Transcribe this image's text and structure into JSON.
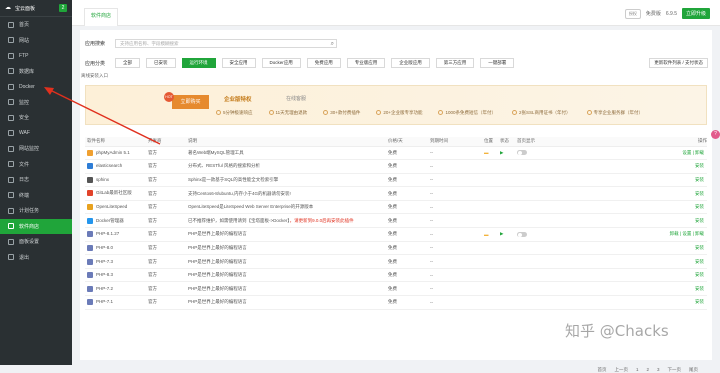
{
  "sidebar": {
    "title": "宝云面板",
    "badge": "2",
    "items": [
      {
        "label": "首页"
      },
      {
        "label": "网站"
      },
      {
        "label": "FTP"
      },
      {
        "label": "数据库"
      },
      {
        "label": "Docker"
      },
      {
        "label": "监控"
      },
      {
        "label": "安全"
      },
      {
        "label": "WAF"
      },
      {
        "label": "网站监控"
      },
      {
        "label": "文件"
      },
      {
        "label": "日志"
      },
      {
        "label": "终端"
      },
      {
        "label": "计划任务"
      },
      {
        "label": "软件商店"
      },
      {
        "label": "面板设置"
      },
      {
        "label": "退出"
      }
    ]
  },
  "topbar": {
    "tab": "软件商店",
    "plan": "免费版",
    "version": "6.9.5",
    "upgrade": "立即升级",
    "tag": "授权"
  },
  "search": {
    "label": "应用搜索",
    "placeholder": "支持应用名称、字段模糊搜索"
  },
  "categories": {
    "label": "应用分类",
    "items": [
      "全部",
      "已安装",
      "运行环境",
      "安全应用",
      "Docker应用",
      "免费应用",
      "专业版应用",
      "企业版应用",
      "第三方应用",
      "一键部署"
    ],
    "refresh": "更新软件列表 / 支付状态"
  },
  "banner": {
    "hot": "HOT",
    "buy": "立即购买",
    "title": "企业版特权",
    "subtitle": "在线客服",
    "features": [
      "5分钟极速响应",
      "11天无理由退款",
      "30+款付费插件",
      "20+企业版专享功能",
      "1000条免费短信（年付）",
      "2张SSL商用证书（年付）",
      "专享企业服务群（年付）"
    ],
    "link": "离线安装入口"
  },
  "table": {
    "headers": [
      "软件名称",
      "开发商",
      "说明",
      "价格/天",
      "到期时间",
      "位置",
      "状态",
      "首页显示",
      "操作"
    ],
    "rows": [
      {
        "name": "phpMyAdmin 5.1",
        "vendor": "官方",
        "desc": "著名Web端MySQL管理工具",
        "price": "免费",
        "expire": "--",
        "installed": true,
        "ops": "设置 | 卸载",
        "icon": "#f0a030"
      },
      {
        "name": "elasticsearch",
        "vendor": "官方",
        "desc": "分布式、RESTful 风格的搜索和分析",
        "price": "免费",
        "expire": "--",
        "installed": false,
        "ops": "安装",
        "icon": "#2e7dd6"
      },
      {
        "name": "sphinx",
        "vendor": "官方",
        "desc": "Sphinx是一款基于SQL的高性能全文检索引擎",
        "price": "免费",
        "expire": "--",
        "installed": false,
        "ops": "安装",
        "icon": "#555555"
      },
      {
        "name": "GitLab最新社区版",
        "vendor": "官方",
        "desc": "支持Centos6-8/ubuntu,内存小于4G的机器请勿安装!",
        "price": "免费",
        "expire": "--",
        "installed": false,
        "ops": "安装",
        "icon": "#e2432a"
      },
      {
        "name": "OpenLiteSpeed",
        "vendor": "官方",
        "desc": "OpenLiteSpeed是LiteSpeed Web Server Enterprise的开源版本",
        "price": "免费",
        "expire": "--",
        "installed": false,
        "ops": "安装",
        "icon": "#e8a21f"
      },
      {
        "name": "Docker管理器",
        "vendor": "官方",
        "desc": "已不推荐维护，如需使用请到【宝塔面板->Docker】",
        "desc_red": "，请更新到9.0.0后再安装此插件",
        "price": "免费",
        "expire": "--",
        "installed": false,
        "ops": "安装",
        "icon": "#2496ed"
      },
      {
        "name": "PHP-8.1.27",
        "vendor": "官方",
        "desc": "PHP是世界上最好的编程语言",
        "price": "免费",
        "expire": "--",
        "installed": true,
        "ops": "卸载 | 设置 | 卸载",
        "icon": "#6b7bb8"
      },
      {
        "name": "PHP-8.0",
        "vendor": "官方",
        "desc": "PHP是世界上最好的编程语言",
        "price": "免费",
        "expire": "--",
        "installed": false,
        "ops": "安装",
        "icon": "#6b7bb8"
      },
      {
        "name": "PHP-7.3",
        "vendor": "官方",
        "desc": "PHP是世界上最好的编程语言",
        "price": "免费",
        "expire": "--",
        "installed": false,
        "ops": "安装",
        "icon": "#6b7bb8"
      },
      {
        "name": "PHP-8.3",
        "vendor": "官方",
        "desc": "PHP是世界上最好的编程语言",
        "price": "免费",
        "expire": "--",
        "installed": false,
        "ops": "安装",
        "icon": "#6b7bb8"
      },
      {
        "name": "PHP-7.2",
        "vendor": "官方",
        "desc": "PHP是世界上最好的编程语言",
        "price": "免费",
        "expire": "--",
        "installed": false,
        "ops": "安装",
        "icon": "#6b7bb8"
      },
      {
        "name": "PHP-7.1",
        "vendor": "官方",
        "desc": "PHP是世界上最好的编程语言",
        "price": "免费",
        "expire": "--",
        "installed": false,
        "ops": "安装",
        "icon": "#6b7bb8"
      }
    ]
  },
  "pager": [
    "首页",
    "上一页",
    "1",
    "2",
    "3",
    "下一页",
    "尾页"
  ],
  "watermark": "知乎 @Chacks",
  "colors": {
    "accent": "#20a53a",
    "sidebar": "#2a3033",
    "annotation": "#e0301e"
  }
}
